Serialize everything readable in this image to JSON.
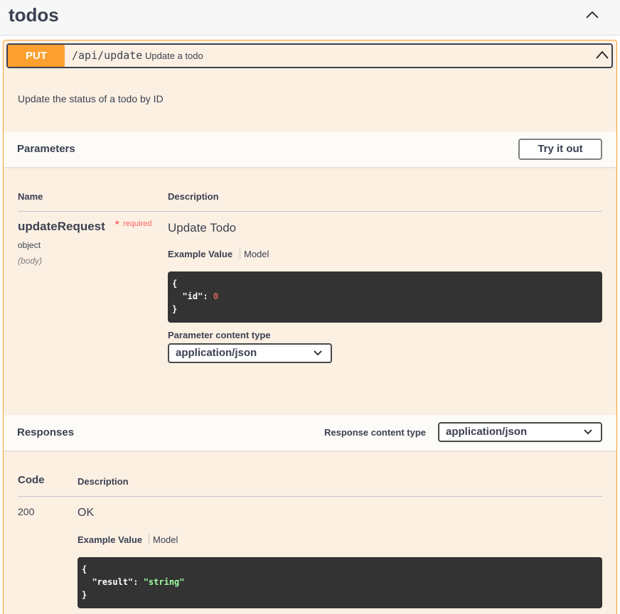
{
  "tag": {
    "title": "todos"
  },
  "operation": {
    "method": "PUT",
    "path": "/api/update",
    "summary": "Update a todo",
    "description": "Update the status of a todo by ID",
    "accent_color": "#fca130"
  },
  "parameters": {
    "title": "Parameters",
    "try_label": "Try it out",
    "col_name": "Name",
    "col_description": "Description",
    "param": {
      "name": "updateRequest",
      "required_star": "*",
      "required_label": "required",
      "type": "object",
      "in": "(body)",
      "description": "Update Todo",
      "example_tab": "Example Value",
      "model_tab": "Model",
      "code_open": "{",
      "code_key": "\"id\"",
      "code_colon": ": ",
      "code_value": "0",
      "code_close": "}",
      "content_type_label": "Parameter content type",
      "content_type_value": "application/json"
    }
  },
  "responses": {
    "title": "Responses",
    "content_type_label": "Response content type",
    "content_type_value": "application/json",
    "col_code": "Code",
    "col_description": "Description",
    "row": {
      "code": "200",
      "description": "OK",
      "example_tab": "Example Value",
      "model_tab": "Model",
      "code_open": "{",
      "code_key": "\"result\"",
      "code_colon": ": ",
      "code_value": "\"string\"",
      "code_close": "}"
    }
  }
}
